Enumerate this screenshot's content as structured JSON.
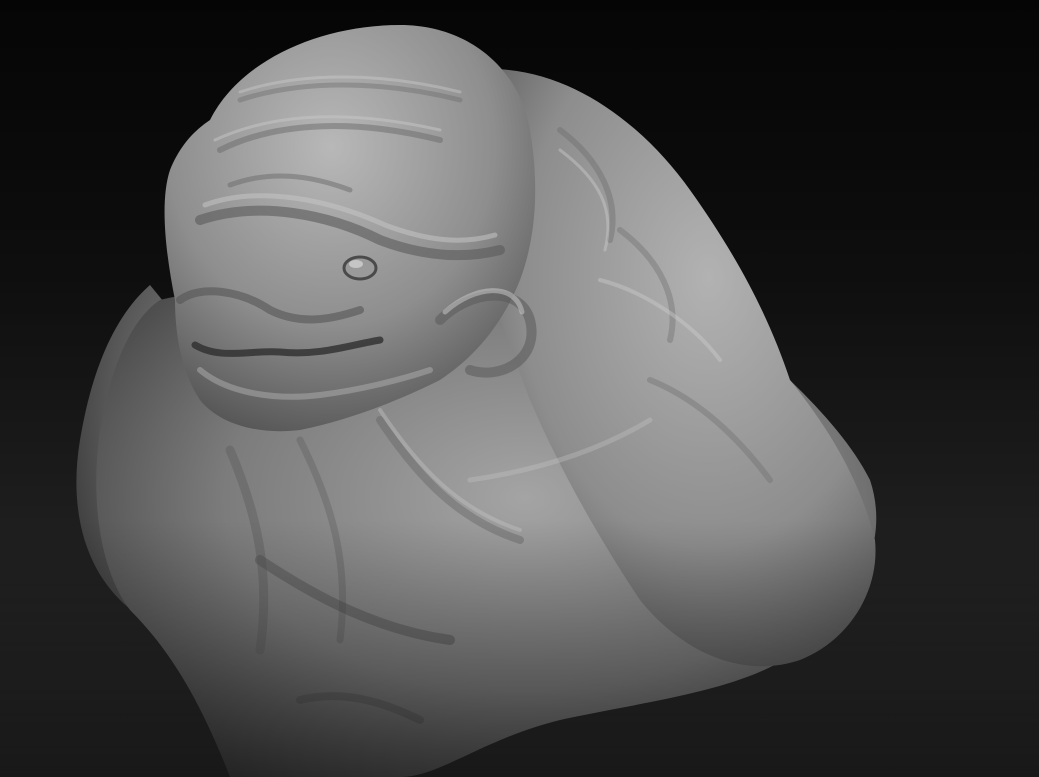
{
  "viewport": {
    "content": "sculpted-creature-bust",
    "material_color": "#8a8a8a",
    "background_top": "#050505",
    "background_bottom": "#2c2c2c"
  }
}
